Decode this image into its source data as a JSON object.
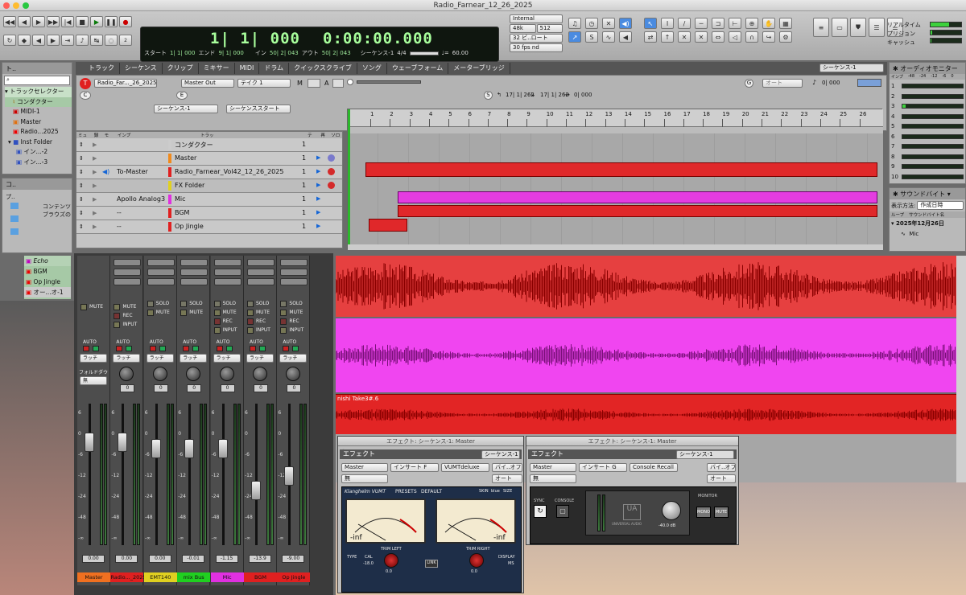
{
  "window": {
    "title": "Radio_Farnear_12_26_2025"
  },
  "counter": {
    "main": "1| 1| 000",
    "secondary": "0:00:00.000",
    "start_label": "スタート",
    "start": "1| 1| 000",
    "end_label": "エンド",
    "end": "9| 1| 000",
    "in_label": "イン",
    "in": "50| 2| 043",
    "out_label": "アウト",
    "out": "50| 2| 043",
    "sequence": "シーケンス-1",
    "tempo": "60.00",
    "meter_top": "4",
    "meter_bottom": "4"
  },
  "sync": {
    "clock": "Internal",
    "rate": "48k",
    "buffer": "512",
    "bit": "32 ビ..ロート",
    "fps": "30 fps nd"
  },
  "cpu": {
    "realtime": "リアルタイム",
    "protection": "プリジョン",
    "cache": "キャッシュ"
  },
  "left_panel": {
    "header": "ト..",
    "selector_title": "トラックセレクター",
    "items": [
      "コンダクター",
      "MIDI-1",
      "Master",
      "Radio...2025",
      "Inst Folder",
      "イン...-2",
      "イン...-3"
    ],
    "browser_header": "コ..",
    "browser_items": [
      "プロ..",
      "コンテンツ",
      "ブラウズの"
    ],
    "pl": "プ.."
  },
  "lower_left": {
    "items": [
      "Echo",
      "BGM",
      "Op Jingle",
      "オー...オ-1"
    ]
  },
  "editor_tabs": [
    "トラック",
    "シーケンス",
    "クリップ",
    "ミキサー",
    "MIDI",
    "ドラム",
    "クイックスクライブ",
    "ソング",
    "ウェーブフォーム",
    "メーターブリッジ"
  ],
  "editor_seq": "シーケンス-1",
  "inspector": {
    "track_name": "Radio_Far..._26_2025",
    "output": "Master Out",
    "take": "テイク 1",
    "m_label": "M",
    "a_label": "A",
    "sequence": "シーケンス-1",
    "seq_start": "シーケンススタート",
    "c_label": "C",
    "e_label": "E",
    "s_label": "S",
    "s_in": "17| 1| 262",
    "s_out": "17| 1| 262",
    "s_len": "0| 000",
    "g_label": "G",
    "auto": "オート",
    "zoom_val": "0| 000"
  },
  "track_headers": {
    "mute": "ミュート",
    "rec": "録音",
    "monitor": "モニタ",
    "input": "インプット",
    "name": "トラック名",
    "take": "テイク",
    "play": "再生",
    "solo": "ソロ表示"
  },
  "tracks": [
    {
      "input": "",
      "name": "コンダクター",
      "take": "1",
      "color": "#cccccc"
    },
    {
      "input": "",
      "name": "Master",
      "take": "1",
      "color": "#f08a1c"
    },
    {
      "input": "To-Master",
      "name": "Radio_Farnear_Vol42_12_26_2025",
      "take": "1",
      "color": "#e02020"
    },
    {
      "input": "",
      "name": "FX Folder",
      "take": "1",
      "color": "#e0d020"
    },
    {
      "input": "Apollo Analog3",
      "name": "Mic",
      "take": "1",
      "color": "#e030e0"
    },
    {
      "input": "--",
      "name": "BGM",
      "take": "1",
      "color": "#e02020"
    },
    {
      "input": "--",
      "name": "Op Jingle",
      "take": "1",
      "color": "#e02020"
    }
  ],
  "ruler": [
    "1",
    "2",
    "3",
    "4",
    "5",
    "6",
    "7",
    "8",
    "9",
    "10",
    "11",
    "12",
    "13",
    "14",
    "15",
    "16",
    "17",
    "18",
    "19",
    "20",
    "21",
    "22",
    "23",
    "24",
    "25",
    "26"
  ],
  "clip_label": "nishi Take3#.6",
  "audio_monitor": {
    "title": "オーディオモニター",
    "header": [
      "インプ",
      "-48",
      "-24",
      "-12",
      "-6",
      "0"
    ],
    "rows": [
      "1",
      "2",
      "3",
      "4",
      "5",
      "6",
      "7",
      "8",
      "9",
      "10"
    ]
  },
  "soundbite": {
    "title": "サウンドバイト",
    "display_label": "表示方法:",
    "display": "作成日時",
    "col1": "ループ",
    "col2": "サウンドバイト名",
    "date": "2025年12月26日",
    "item": "Mic"
  },
  "mixer": {
    "channels": [
      {
        "name": "Master",
        "value": "0.00",
        "color": "#f07020",
        "buttons": [
          "MUTE"
        ],
        "auto": "AUTO",
        "mode": "ラッチ",
        "knob": "",
        "extra": "フォルドダウン",
        "extra2": "無"
      },
      {
        "name": "Radio..._2025",
        "value": "0.00",
        "color": "#e02020",
        "buttons": [
          "MUTE",
          "REC",
          "INPUT"
        ],
        "auto": "AUTO",
        "mode": "ラッチ",
        "knob": "0"
      },
      {
        "name": "EMT140",
        "value": "0.00",
        "color": "#e0d020",
        "buttons": [
          "SOLO",
          "MUTE"
        ],
        "auto": "AUTO",
        "mode": "ラッチ",
        "knob": "0"
      },
      {
        "name": "mix Bus",
        "value": "-0.01",
        "color": "#20d020",
        "buttons": [
          "SOLO",
          "MUTE"
        ],
        "auto": "AUTO",
        "mode": "ラッチ",
        "knob": "0"
      },
      {
        "name": "Mic",
        "value": "-1.15",
        "color": "#e030e0",
        "buttons": [
          "SOLO",
          "MUTE",
          "REC",
          "INPUT"
        ],
        "auto": "AUTO",
        "mode": "ラッチ",
        "knob": "0"
      },
      {
        "name": "BGM",
        "value": "-13.9",
        "color": "#e02020",
        "buttons": [
          "SOLO",
          "MUTE",
          "REC",
          "INPUT"
        ],
        "auto": "AUTO",
        "mode": "ラッチ",
        "knob": "0"
      },
      {
        "name": "Op Jingle",
        "value": "-9.00",
        "color": "#e02020",
        "buttons": [
          "SOLO",
          "MUTE",
          "REC",
          "INPUT"
        ],
        "auto": "AUTO",
        "mode": "ラッチ",
        "knob": "0"
      }
    ],
    "scale": [
      "6",
      "0",
      "-6",
      "-12",
      "-24",
      "-48",
      "-∞"
    ]
  },
  "plugin1": {
    "title": "エフェクト: シーケンス-1: Master",
    "label": "エフェクト",
    "seq": "シーケンス-1",
    "track": "Master",
    "insert": "インサート F",
    "name": "VUMTdeluxe",
    "bypass": "バイ..オフ",
    "preset": "無",
    "auto": "オート",
    "brand": "Klanghelm VUMT",
    "presets": "PRESETS",
    "default": "DEFAULT",
    "skin": "SKIN",
    "skin_val": "blue",
    "size": "SIZE",
    "trim_left": "TRIM LEFT",
    "trim_right": "TRIM RIGHT",
    "type": "TYPE",
    "cal": "CAL",
    "link": "LINK",
    "display": "DISPLAY",
    "trim_left_val": "0.0",
    "trim_right_val": "0.0",
    "cal_val": "-18.0",
    "vu_inf": "-inf",
    "ms": "MS"
  },
  "plugin2": {
    "title": "エフェクト: シーケンス-1: Master",
    "label": "エフェクト",
    "seq": "シーケンス-1",
    "track": "Master",
    "insert": "インサート G",
    "name": "Console Recall",
    "bypass": "バイ..オフ",
    "preset": "無",
    "auto": "オート",
    "sync": "SYNC",
    "console": "CONSOLE",
    "monitor": "MONITOR",
    "mono": "MONO",
    "mute": "MUTE",
    "level": "-40.0 dB",
    "brand": "UNIVERSAL AUDIO"
  }
}
